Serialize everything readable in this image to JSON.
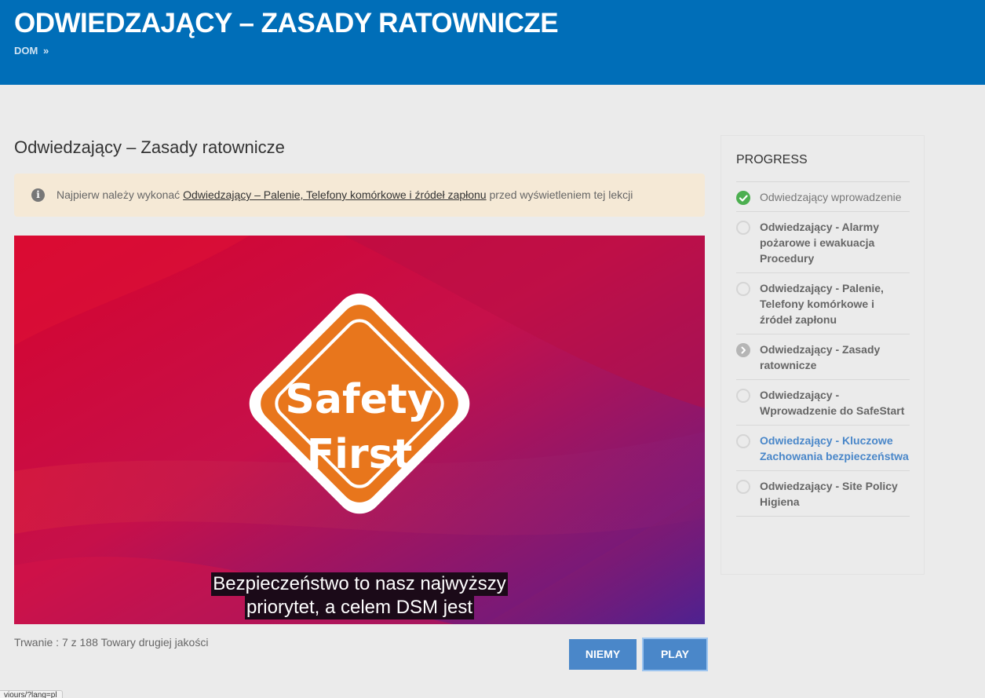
{
  "header": {
    "title": "ODWIEDZAJĄCY – ZASADY RATOWNICZE",
    "breadcrumb_home": "DOM",
    "breadcrumb_sep": "»"
  },
  "lesson": {
    "title": "Odwiedzający – Zasady ratownicze"
  },
  "notice": {
    "prefix": "Najpierw należy wykonać ",
    "link": "Odwiedzający – Palenie, Telefony komórkowe i źródeł zapłonu",
    "suffix": " przed wyświetleniem tej lekcji"
  },
  "video": {
    "sign_line1": "Safety",
    "sign_line2": "First",
    "caption_line1": "Bezpieczeństwo to nasz najwyższy",
    "caption_line2": "priorytet, a celem DSM jest"
  },
  "duration": "Trwanie : 7 z 188 Towary drugiej jakości",
  "buttons": {
    "mute": "NIEMY",
    "play": "PLAY"
  },
  "sidebar": {
    "title": "PROGRESS",
    "items": [
      {
        "label": "Odwiedzający wprowadzenie",
        "status": "completed"
      },
      {
        "label": "Odwiedzający - Alarmy pożarowe i ewakuacja Procedury",
        "status": "not-started"
      },
      {
        "label": "Odwiedzający - Palenie, Telefony komórkowe i źródeł zapłonu",
        "status": "not-started"
      },
      {
        "label": "Odwiedzający - Zasady ratownicze",
        "status": "current"
      },
      {
        "label": "Odwiedzający - Wprowadzenie do SafeStart",
        "status": "not-started"
      },
      {
        "label": "Odwiedzający - Kluczowe Zachowania bezpieczeństwa",
        "status": "not-started"
      },
      {
        "label": "Odwiedzający - Site Policy Higiena",
        "status": "not-started"
      }
    ]
  },
  "url_tip": "viours/?lang=pl",
  "colors": {
    "header_bg": "#006eb8",
    "button_bg": "#4a87c9",
    "notice_bg": "#f5e9d6",
    "sign_orange": "#e8761c",
    "completed_green": "#4caf50"
  }
}
